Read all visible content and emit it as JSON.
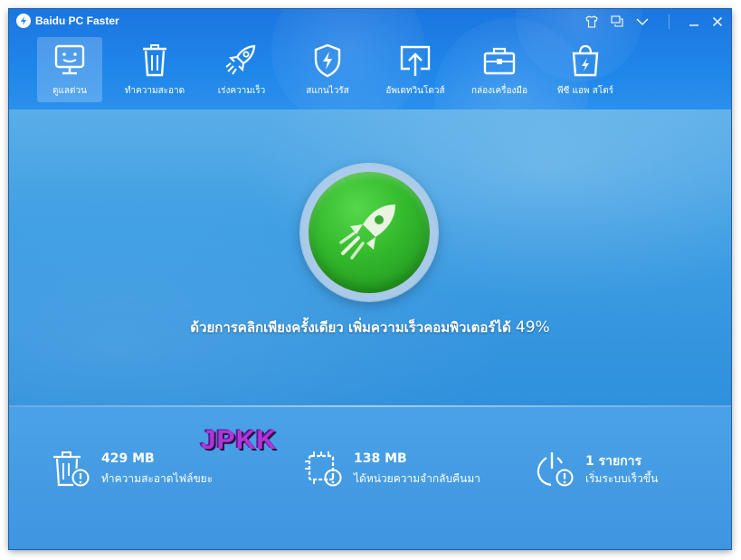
{
  "app": {
    "title": "Baidu PC Faster"
  },
  "titlebar": {
    "buttons": [
      "skin-icon",
      "feedback-icon",
      "menu-chevron-icon",
      "minimize-icon",
      "close-icon"
    ]
  },
  "nav": {
    "items": [
      {
        "label": "ดูแลด่วน",
        "icon": "monitor-face-icon",
        "active": true
      },
      {
        "label": "ทำความสะอาด",
        "icon": "trash-icon",
        "active": false
      },
      {
        "label": "เร่งความเร็ว",
        "icon": "rocket-icon",
        "active": false
      },
      {
        "label": "สแกนไวรัส",
        "icon": "shield-icon",
        "active": false
      },
      {
        "label": "อัพเดทวินโดวส์",
        "icon": "upload-icon",
        "active": false
      },
      {
        "label": "กล่องเครื่องมือ",
        "icon": "toolbox-icon",
        "active": false
      },
      {
        "label": "พีซี แอพ สโตร์",
        "icon": "store-bag-icon",
        "active": false
      }
    ]
  },
  "main": {
    "headline_text": "ด้วยการคลิกเพียงครั้งเดียว เพิ่มความเร็วคอมพิวเตอร์ได้",
    "headline_pct": "49%"
  },
  "stats": [
    {
      "value": "429 MB",
      "label": "ทำความสะอาดไฟล์ขยะ",
      "icon": "trash-warning-icon"
    },
    {
      "value": "138 MB",
      "label": "ได้หน่วยความจำกลับคืนมา",
      "icon": "memory-warning-icon"
    },
    {
      "value": "1 รายการ",
      "label": "เริ่มระบบเร็วขึ้น",
      "icon": "power-warning-icon"
    }
  ],
  "watermark": "JPKK",
  "colors": {
    "header": "#1f86ea",
    "accent_green": "#33b82c",
    "watermark": "#b036d8"
  }
}
